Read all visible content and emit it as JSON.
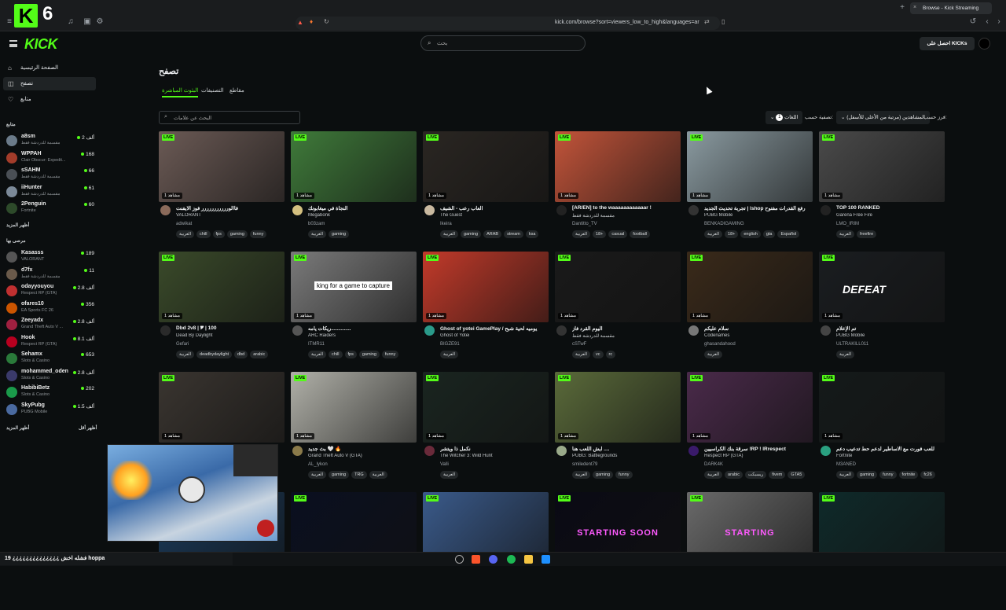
{
  "browser": {
    "channel_logo": "K",
    "channel_num": "6",
    "tab_title": "Browse - Kick Streaming",
    "url": "kick.com/browse?sort=viewers_low_to_high&languages=ar"
  },
  "header": {
    "wordmark": "KICK",
    "search_placeholder": "بحث",
    "get_kicks": "احصل على KICKs"
  },
  "sidebar": {
    "nav": [
      {
        "label": "الصفحة الرئيسية",
        "icon": "home-icon"
      },
      {
        "label": "تصفح",
        "icon": "browse-icon"
      },
      {
        "label": "متابع",
        "icon": "heart-icon"
      }
    ],
    "following_title": "متابع",
    "following": [
      {
        "name": "a8sm",
        "cat": "مقسمة للدردشة فقط",
        "viewers": "2 ألف",
        "color": "#6b7b8a"
      },
      {
        "name": "WPPAH",
        "cat": "Clair Obscur: Expedit...",
        "viewers": "168",
        "color": "#a33c2a"
      },
      {
        "name": "sSAHM",
        "cat": "مقسمة للدردشة فقط",
        "viewers": "66",
        "color": "#4a4f55"
      },
      {
        "name": "iiHunter",
        "cat": "مقسمة للدردشة فقط",
        "viewers": "61",
        "color": "#7c8a99"
      },
      {
        "name": "2Penguin",
        "cat": "Fortnite",
        "viewers": "60",
        "color": "#2d4a2a"
      }
    ],
    "show_more_1": "أظهر المزيد",
    "recommended_title": "مرصى بها",
    "recommended": [
      {
        "name": "Kasasss",
        "cat": "VALORANT",
        "viewers": "189",
        "color": "#555"
      },
      {
        "name": "d7fx",
        "cat": "مقسمة للدردشة فقط",
        "viewers": "11",
        "color": "#6a5a4a"
      },
      {
        "name": "odayyouyou",
        "cat": "Respect RP (GTA)",
        "viewers": "2.8 ألف",
        "color": "#c03030"
      },
      {
        "name": "ofares10",
        "cat": "EA Sports FC 26",
        "viewers": "356",
        "color": "#cc5500"
      },
      {
        "name": "Zeeyadx",
        "cat": "Grand Theft Auto V ...",
        "viewers": "2.8 ألف",
        "color": "#a02040"
      },
      {
        "name": "Hook",
        "cat": "Respect RP (GTA)",
        "viewers": "8.1 ألف",
        "color": "#b8001f"
      },
      {
        "name": "Sehamx",
        "cat": "Slots & Casino",
        "viewers": "653",
        "color": "#2a7a3a"
      },
      {
        "name": "mohammed_oden",
        "cat": "Slots & Casino",
        "viewers": "2.8 ألف",
        "color": "#3a3a6a"
      },
      {
        "name": "HabibiBetz",
        "cat": "Slots & Casino",
        "viewers": "202",
        "color": "#1a9a4a"
      },
      {
        "name": "SkyPubg",
        "cat": "PUBG Mobile",
        "viewers": "1.5 ألف",
        "color": "#4a6aa0"
      }
    ],
    "show_more_2": "أظهر المزيد",
    "show_less": "أظهر أقل"
  },
  "main": {
    "title": "تصفح",
    "tabs": [
      "البثوث المباشرة",
      "التصنيفات",
      "مقاطع"
    ],
    "tag_search_placeholder": "البحث عن علامات",
    "sort_label": "فرز حسب:",
    "sort_value": "المشاهدين (مرتبة من الأعلى للأسفل)",
    "filter_label": "تصفية حسب:",
    "filter_value": "اللغات",
    "filter_count": "1"
  },
  "cards": [
    {
      "title": "فاالوررررررررررر فوز الايفنت",
      "cat": "VALORANT",
      "streamer": "adwikat",
      "tags": [
        "العربية",
        "chill",
        "fps",
        "gaming",
        "funny"
      ],
      "viewers": "1 مشاهد",
      "bg": "#6b5a55",
      "av": "#8a6a5a"
    },
    {
      "title": "النجاة في ميغابونك",
      "cat": "Megabonk",
      "streamer": "b03zam",
      "tags": [
        "العربية",
        "gaming"
      ],
      "viewers": "1 مشاهد",
      "bg": "#3f7a3a",
      "av": "#d4c080"
    },
    {
      "title": "العاب رعب - الشيف",
      "cat": "The Guest",
      "streamer": "Ikeira",
      "tags": [
        "العربية",
        "gaming",
        "ARAB",
        "stream",
        "ksa"
      ],
      "viewers": "1 مشاهد",
      "bg": "#2a2622",
      "av": "#c9b9a0"
    },
    {
      "title": "[AR/EN] to the waaaaaaaaaaaar !",
      "cat": "مقسمة للدردشة فقط",
      "streamer": "Dantitto_TV",
      "tags": [
        "العربية",
        "18+",
        "casual",
        "football"
      ],
      "viewers": "1 مشاهد",
      "bg": "#c2543a",
      "av": "#222"
    },
    {
      "title": "تجربة تحديث الجديد | lshop رفع القدرات مفتوح",
      "cat": "PUBG Mobile",
      "streamer": "BENKADIGAMING",
      "tags": [
        "العربية",
        "18+",
        "english",
        "gta",
        "Español"
      ],
      "viewers": "1 مشاهد",
      "bg": "#8a9aa0",
      "av": "#333"
    },
    {
      "title": "TOP 100 RANKED",
      "cat": "Garena Free Fire",
      "streamer": "LMO_IRIM",
      "tags": [
        "العربية",
        "freefire"
      ],
      "viewers": "1 مشاهد",
      "bg": "#4a4a4a",
      "av": "#222"
    },
    {
      "title": "Dbd 2v8 | 🎔 | 100",
      "cat": "Dead By Daylight",
      "streamer": "Gefari",
      "tags": [
        "العربية",
        "deadbydaylight",
        "dbd",
        "arabic"
      ],
      "viewers": "1 مشاهد",
      "bg": "#3a4a2a",
      "av": "#2a2a2a"
    },
    {
      "title": "ريكات يامه..............",
      "cat": "ARC Raiders",
      "streamer": "ITMR11",
      "tags": [
        "العربية",
        "chill",
        "fps",
        "gaming",
        "funny"
      ],
      "viewers": "1 مشاهد",
      "bg": "#7a7a7a",
      "av": "#555"
    },
    {
      "title": "Ghost of yotei GamePlay / يوميه لحية شبح",
      "cat": "Ghost of Yotei",
      "streamer": "BIGZE91",
      "tags": [
        "العربية"
      ],
      "viewers": "1 مشاهد",
      "bg": "#c23a2a",
      "av": "#2a9a8a"
    },
    {
      "title": "اليوم القرد فاز",
      "cat": "مقسمة للدردشة فقط",
      "streamer": "cSTwF",
      "tags": [
        "العربية",
        "vc",
        "rc"
      ],
      "viewers": "1 مشاهد",
      "bg": "#1a1a1a",
      "av": "#333"
    },
    {
      "title": "سلام عليكم",
      "cat": "Codenames",
      "streamer": "ghasandahood",
      "tags": [
        "العربية"
      ],
      "viewers": "1 مشاهد",
      "bg": "#3a2a1a",
      "av": "#777"
    },
    {
      "title": "تم الإعلام",
      "cat": "PUBG Mobile",
      "streamer": "ULTRAKILL011",
      "tags": [
        "العربية"
      ],
      "viewers": "1 مشاهد",
      "bg": "#1a1d20",
      "av": "#444"
    },
    {
      "title": "",
      "cat": "",
      "streamer": "",
      "tags": [],
      "viewers": "1 مشاهد",
      "bg": "#3a3530",
      "av": "#444"
    },
    {
      "title": "بث جديد 🤍 🔥",
      "cat": "Grand Theft Auto V (GTA)",
      "streamer": "AL_lykon",
      "tags": [
        "العربية",
        "gaming",
        "TRG",
        "العربية"
      ],
      "viewers": "1 مشاهد",
      "bg": "#b0b0a8",
      "av": "#8a7a4a"
    },
    {
      "title": "نكمل ذا ويتشر",
      "cat": "The Witcher 3: Wild Hunt",
      "streamer": "Valli",
      "tags": [
        "العربية"
      ],
      "viewers": "1 مشاهد",
      "bg": "#1a2520",
      "av": "#6a2a3a"
    },
    {
      "title": "ايش اللعب هنا ....",
      "cat": "PUBG: Battlegrounds",
      "streamer": "smiledent79",
      "tags": [
        "العربية",
        "gaming",
        "funny"
      ],
      "viewers": "1 مشاهد",
      "bg": "#5a6a3a",
      "av": "#9aaa8a"
    },
    {
      "title": "سرقة بنك الكراسيين !RP ! lRrespect",
      "cat": "Respect RP (GTA)",
      "streamer": "DARK4K",
      "tags": [
        "العربية",
        "arabic",
        "ريسبكت",
        "fivem",
        "GTA5"
      ],
      "viewers": "1 مشاهد",
      "bg": "#4a2a4a",
      "av": "#3a1a6a"
    },
    {
      "title": "للعب فورت مع الاساطير لدعم حط تدعيب دعم",
      "cat": "Fortnite",
      "streamer": "M3ANED",
      "tags": [
        "العربية",
        "gaming",
        "funny",
        "fortnite",
        "fc26"
      ],
      "viewers": "1 مشاهد",
      "bg": "#151a1a",
      "av": "#2aa080"
    },
    {
      "title": "",
      "cat": "",
      "streamer": "",
      "tags": [],
      "viewers": "",
      "bg": "#1a3a5a",
      "av": "#333"
    },
    {
      "title": "",
      "cat": "",
      "streamer": "",
      "tags": [],
      "viewers": "",
      "bg": "#0a0f20",
      "av": "#333"
    },
    {
      "title": "",
      "cat": "",
      "streamer": "",
      "tags": [],
      "viewers": "",
      "bg": "#3a5a8a",
      "av": "#333"
    },
    {
      "title": "",
      "cat": "",
      "streamer": "",
      "tags": [],
      "viewers": "",
      "bg": "#0a0a14",
      "av": "#333",
      "overlay": "STARTING SOON"
    },
    {
      "title": "",
      "cat": "",
      "streamer": "",
      "tags": [],
      "viewers": "",
      "bg": "#6a6a6a",
      "av": "#333",
      "overlay": "STARTING"
    },
    {
      "title": "",
      "cat": "",
      "streamer": "",
      "tags": [],
      "viewers": "",
      "bg": "#0f2a2a",
      "av": "#333"
    }
  ],
  "live_label": "LIVE",
  "thumb_captions": {
    "arc": "king for a game to capture",
    "defeat": "DEFEAT"
  },
  "chat_overlay": "فشله اخش ¿¿¿¿¿¿¿¿¿¿¿¿¿¿ 19 hoppa"
}
